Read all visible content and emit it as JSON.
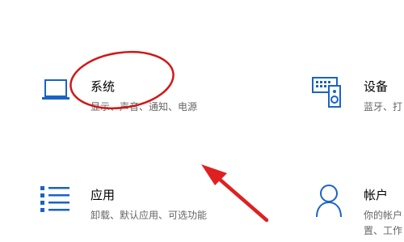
{
  "tiles": {
    "system": {
      "title": "系统",
      "description": "显示、声音、通知、电源",
      "icon": "laptop-icon"
    },
    "devices": {
      "title": "设备",
      "description": "蓝牙、打",
      "icon": "keyboard-speaker-icon"
    },
    "apps": {
      "title": "应用",
      "description": "卸载、默认应用、可选功能",
      "icon": "apps-list-icon"
    },
    "accounts": {
      "title": "帐户",
      "description_line1": "你的帐户",
      "description_line2": "置、工作",
      "icon": "person-icon"
    }
  },
  "annotations": {
    "circle_color": "#d01818",
    "arrow_color": "#e02020"
  },
  "colors": {
    "icon_accent": "#1b63c6"
  }
}
